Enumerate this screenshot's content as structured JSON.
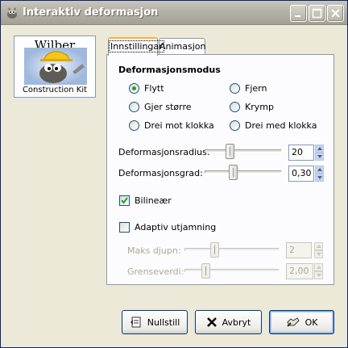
{
  "window": {
    "title": "Interaktiv deformasjon",
    "controls": [
      "minimize-icon",
      "maximize-icon",
      "close-icon"
    ]
  },
  "logo": {
    "line1": "Wilber",
    "line2": "Construction Kit"
  },
  "tabs": [
    {
      "label": "Innstillingar",
      "active": true
    },
    {
      "label": "Animasjon",
      "active": false
    }
  ],
  "mode": {
    "heading": "Deformasjonsmodus",
    "options": [
      {
        "label": "Flytt",
        "selected": true
      },
      {
        "label": "Fjern",
        "selected": false
      },
      {
        "label": "Gjer større",
        "selected": false
      },
      {
        "label": "Krymp",
        "selected": false
      },
      {
        "label": "Drei mot klokka",
        "selected": false
      },
      {
        "label": "Drei med klokka",
        "selected": false
      }
    ]
  },
  "radius": {
    "label": "Deformasjonsradius:",
    "value": "20",
    "level": 0.3
  },
  "amount": {
    "label": "Deformasjonsgrad:",
    "value": "0,30",
    "level": 0.35
  },
  "bilinear": {
    "label": "Bilineær",
    "checked": true
  },
  "adaptive": {
    "label": "Adaptiv utjamning",
    "checked": false,
    "max_depth": {
      "label": "Maks djupn:",
      "value": "2",
      "level": 0.3
    },
    "threshold": {
      "label": "Grenseverdi:",
      "value": "2,00",
      "level": 0.2
    }
  },
  "buttons": {
    "reset": "Nullstill",
    "cancel": "Avbryt",
    "ok": "OK"
  },
  "colors": {
    "accent": "#f8b33c",
    "radio_dot": "#21a121",
    "checkmark": "#21a121"
  }
}
